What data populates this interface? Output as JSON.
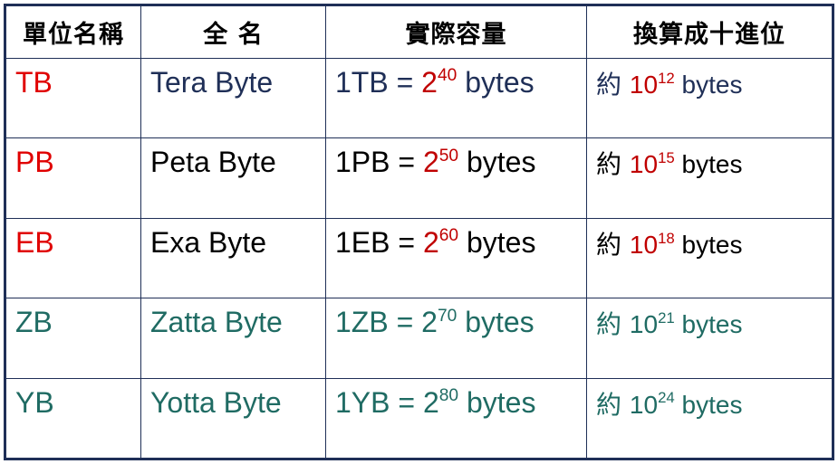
{
  "colors": {
    "border": "#1f2f57",
    "red": "#e00000",
    "dark_red": "#c00000",
    "blue": "#1f2f57",
    "black": "#000000",
    "teal": "#1f6b63"
  },
  "table": {
    "headers": [
      "單位名稱",
      "全 名",
      "實際容量",
      "換算成十進位"
    ],
    "rows": [
      {
        "unit": "TB",
        "full_name": "Tera Byte",
        "actual_prefix": "1TB = ",
        "actual_base": "2",
        "actual_exp": "40",
        "actual_suffix": " bytes",
        "approx_prefix": "約 ",
        "approx_base": "10",
        "approx_exp": "12",
        "approx_suffix": " bytes",
        "unit_color": "#e00000",
        "name_color": "#1f2f57",
        "actual_color": "#1f2f57",
        "power_color": "#c00000",
        "approx_color": "#1f2f57"
      },
      {
        "unit": "PB",
        "full_name": "Peta Byte",
        "actual_prefix": "1PB = ",
        "actual_base": "2",
        "actual_exp": "50",
        "actual_suffix": " bytes",
        "approx_prefix": "約 ",
        "approx_base": "10",
        "approx_exp": "15",
        "approx_suffix": " bytes",
        "unit_color": "#e00000",
        "name_color": "#000000",
        "actual_color": "#000000",
        "power_color": "#c00000",
        "approx_color": "#000000"
      },
      {
        "unit": "EB",
        "full_name": "Exa Byte",
        "actual_prefix": "1EB = ",
        "actual_base": "2",
        "actual_exp": "60",
        "actual_suffix": " bytes",
        "approx_prefix": "約 ",
        "approx_base": "10",
        "approx_exp": "18",
        "approx_suffix": " bytes",
        "unit_color": "#e00000",
        "name_color": "#000000",
        "actual_color": "#000000",
        "power_color": "#c00000",
        "approx_color": "#000000"
      },
      {
        "unit": "ZB",
        "full_name": "Zatta Byte",
        "actual_prefix": "1ZB = ",
        "actual_base": "2",
        "actual_exp": "70",
        "actual_suffix": " bytes",
        "approx_prefix": "約 ",
        "approx_base": "10",
        "approx_exp": "21",
        "approx_suffix": " bytes",
        "unit_color": "#1f6b63",
        "name_color": "#1f6b63",
        "actual_color": "#1f6b63",
        "power_color": "#1f6b63",
        "approx_color": "#1f6b63"
      },
      {
        "unit": "YB",
        "full_name": "Yotta Byte",
        "actual_prefix": "1YB = ",
        "actual_base": "2",
        "actual_exp": "80",
        "actual_suffix": " bytes",
        "approx_prefix": "約 ",
        "approx_base": "10",
        "approx_exp": "24",
        "approx_suffix": " bytes",
        "unit_color": "#1f6b63",
        "name_color": "#1f6b63",
        "actual_color": "#1f6b63",
        "power_color": "#1f6b63",
        "approx_color": "#1f6b63"
      }
    ]
  }
}
